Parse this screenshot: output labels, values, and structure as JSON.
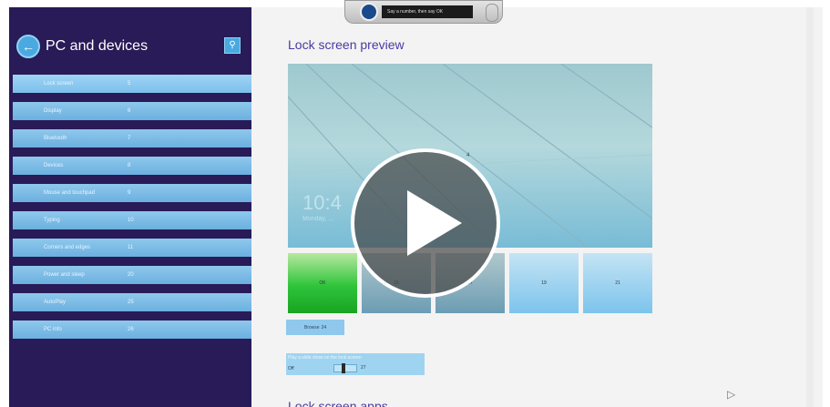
{
  "sidebar": {
    "title": "PC and devices",
    "items": [
      {
        "label": "Lock screen",
        "num": "5"
      },
      {
        "label": "Display",
        "num": "6"
      },
      {
        "label": "Bluetooth",
        "num": "7"
      },
      {
        "label": "Devices",
        "num": "8"
      },
      {
        "label": "Mouse and touchpad",
        "num": "9"
      },
      {
        "label": "Typing",
        "num": "10"
      },
      {
        "label": "Corners and edges",
        "num": "11"
      },
      {
        "label": "Power and sleep",
        "num": "20"
      },
      {
        "label": "AutoPlay",
        "num": "25"
      },
      {
        "label": "PC info",
        "num": "26"
      }
    ]
  },
  "voice_bar": {
    "prompt": "Say a number, then say OK"
  },
  "main": {
    "heading": "Lock screen preview",
    "preview_time": "10:4",
    "preview_date": "Monday, ...",
    "preview_marker": "4",
    "thumbnails": [
      "OK",
      "15",
      "17",
      "19",
      "21"
    ],
    "browse_label": "Browse",
    "browse_num": "24",
    "slideshow_label": "Play a slide show on the lock screen",
    "slideshow_state": "Off",
    "slideshow_num": "27",
    "section2_heading": "Lock screen apps"
  },
  "overlay": {
    "icon": "play-icon"
  },
  "colors": {
    "sidebar_bg": "#281b57",
    "accent": "#4a3aa0",
    "tile_blue": "#7cc4ec",
    "tile_green": "#2ec43a"
  }
}
